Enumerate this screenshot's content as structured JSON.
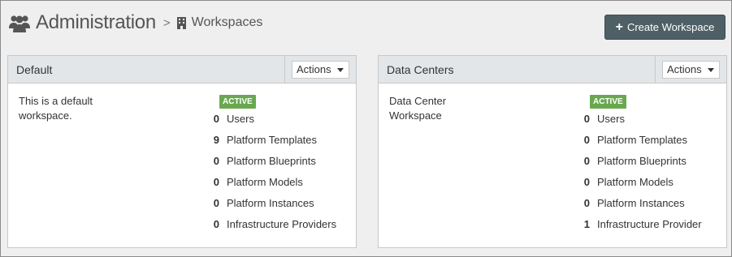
{
  "header": {
    "title": "Administration",
    "separator": ">",
    "crumb": "Workspaces"
  },
  "create_button": {
    "label": "Create Workspace"
  },
  "workspaces": [
    {
      "name": "Default",
      "actions_label": "Actions",
      "description": "This is a default workspace.",
      "status": "ACTIVE",
      "stats": [
        {
          "count": "0",
          "label": "Users"
        },
        {
          "count": "9",
          "label": "Platform Templates"
        },
        {
          "count": "0",
          "label": "Platform Blueprints"
        },
        {
          "count": "0",
          "label": "Platform Models"
        },
        {
          "count": "0",
          "label": "Platform Instances"
        },
        {
          "count": "0",
          "label": "Infrastructure Providers"
        }
      ]
    },
    {
      "name": "Data Centers",
      "actions_label": "Actions",
      "description": "Data Center Workspace",
      "status": "ACTIVE",
      "stats": [
        {
          "count": "0",
          "label": "Users"
        },
        {
          "count": "0",
          "label": "Platform Templates"
        },
        {
          "count": "0",
          "label": "Platform Blueprints"
        },
        {
          "count": "0",
          "label": "Platform Models"
        },
        {
          "count": "0",
          "label": "Platform Instances"
        },
        {
          "count": "1",
          "label": "Infrastructure Provider"
        }
      ]
    }
  ],
  "icons": {
    "title_icon": "users-icon",
    "crumb_icon": "building-icon",
    "button_icon": "plus-icon",
    "dropdown_icon": "caret-down-icon"
  },
  "colors": {
    "button_bg": "#4e5f66",
    "badge_bg": "#6aa84f",
    "panel_header_bg": "#e3e6e8",
    "page_bg": "#efefef"
  }
}
